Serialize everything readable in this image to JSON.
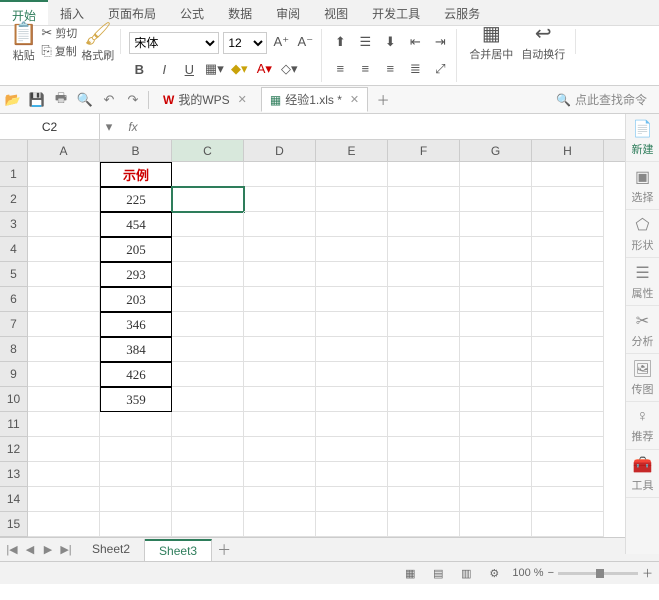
{
  "menu": [
    "开始",
    "插入",
    "页面布局",
    "公式",
    "数据",
    "审阅",
    "视图",
    "开发工具",
    "云服务"
  ],
  "active_menu": 0,
  "clipboard": {
    "paste": "粘贴",
    "cut": "剪切",
    "copy": "复制",
    "fmt": "格式刷"
  },
  "font": {
    "name": "宋体",
    "size": "12"
  },
  "merge": "合并居中",
  "wrap": "自动换行",
  "doctabs": {
    "wps": "我的WPS",
    "file": "经验1.xls *"
  },
  "search": "点此查找命令",
  "namebox": "C2",
  "cols": [
    "A",
    "B",
    "C",
    "D",
    "E",
    "F",
    "G",
    "H"
  ],
  "rows": 15,
  "data": {
    "header": "示例",
    "values": [
      "225",
      "454",
      "205",
      "293",
      "203",
      "346",
      "384",
      "426",
      "359"
    ]
  },
  "sidebar": [
    {
      "ico": "📄",
      "label": "新建",
      "cls": "grn"
    },
    {
      "ico": "▣",
      "label": "选择"
    },
    {
      "ico": "⬠",
      "label": "形状"
    },
    {
      "ico": "☰",
      "label": "属性"
    },
    {
      "ico": "✂",
      "label": "分析"
    },
    {
      "ico": "🖼",
      "label": "传图"
    },
    {
      "ico": "♀",
      "label": "推荐"
    },
    {
      "ico": "🧰",
      "label": "工具"
    }
  ],
  "sheets": [
    "Sheet2",
    "Sheet3"
  ],
  "active_sheet": 1,
  "zoom": "100 %"
}
